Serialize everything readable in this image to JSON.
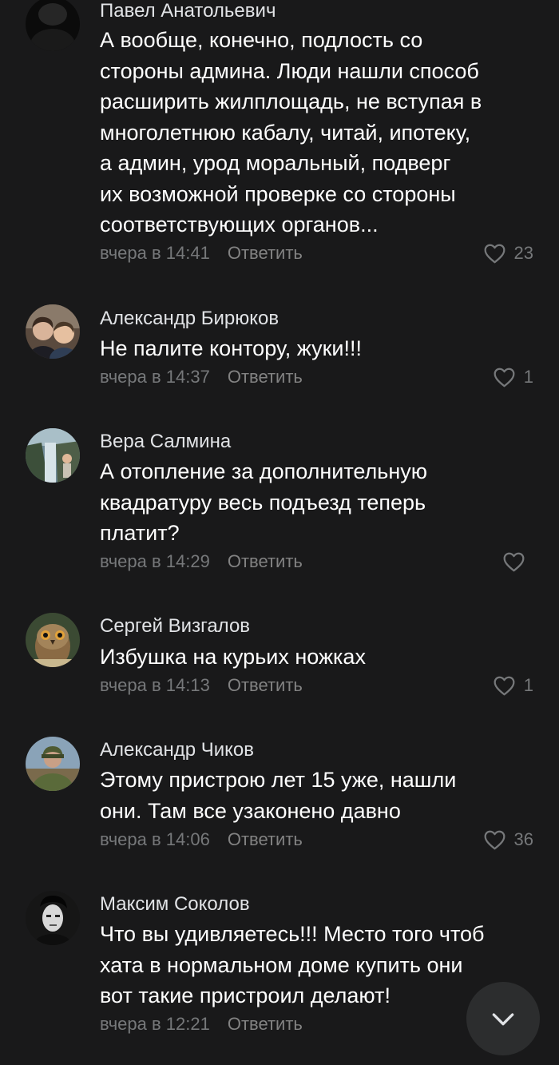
{
  "reply_label": "Ответить",
  "comments": [
    {
      "author": "Павел Анатольевич",
      "lines": [
        "А вообще, конечно, подлость со",
        "стороны админа. Люди нашли способ",
        "расширить жилплощадь, не вступая в",
        "многолетнюю кабалу, читай, ипотеку,",
        "а админ, урод моральный, подверг",
        "их возможной проверке со стороны",
        "соответствующих органов..."
      ],
      "time": "вчера в 14:41",
      "likes": "23",
      "avatar_icon": "dark-profile-photo"
    },
    {
      "author": "Александр Бирюков",
      "lines": [
        "Не палите контору, жуки!!!"
      ],
      "time": "вчера в 14:37",
      "likes": "1",
      "avatar_icon": "two-people-photo"
    },
    {
      "author": "Вера Салмина",
      "lines": [
        "А отопление за дополнительную",
        "квадратуру весь подъезд теперь",
        "платит?"
      ],
      "time": "вчера в 14:29",
      "likes": "",
      "avatar_icon": "waterfall-photo"
    },
    {
      "author": "Сергей Визгалов",
      "lines": [
        "Избушка на курьих ножках"
      ],
      "time": "вчера в 14:13",
      "likes": "1",
      "avatar_icon": "owl-photo"
    },
    {
      "author": "Александр Чиков",
      "lines": [
        "Этому пристрою лет 15 уже, нашли",
        "они. Там все узаконено давно"
      ],
      "time": "вчера в 14:06",
      "likes": "36",
      "avatar_icon": "soldier-photo"
    },
    {
      "author": "Максим Соколов",
      "lines": [
        "Что вы удивляетесь!!! Место того чтоб",
        "хата в нормальном доме купить они",
        "вот такие пристроил делают!"
      ],
      "time": "вчера в 12:21",
      "likes": "",
      "avatar_icon": "portrait-photo"
    }
  ],
  "colors": {
    "background": "#19191a",
    "author": "#e1e3e6",
    "text": "#ffffff",
    "meta": "#76787a",
    "scroll_button": "#2c2d2e"
  },
  "scroll_button_icon": "chevron-down-icon"
}
